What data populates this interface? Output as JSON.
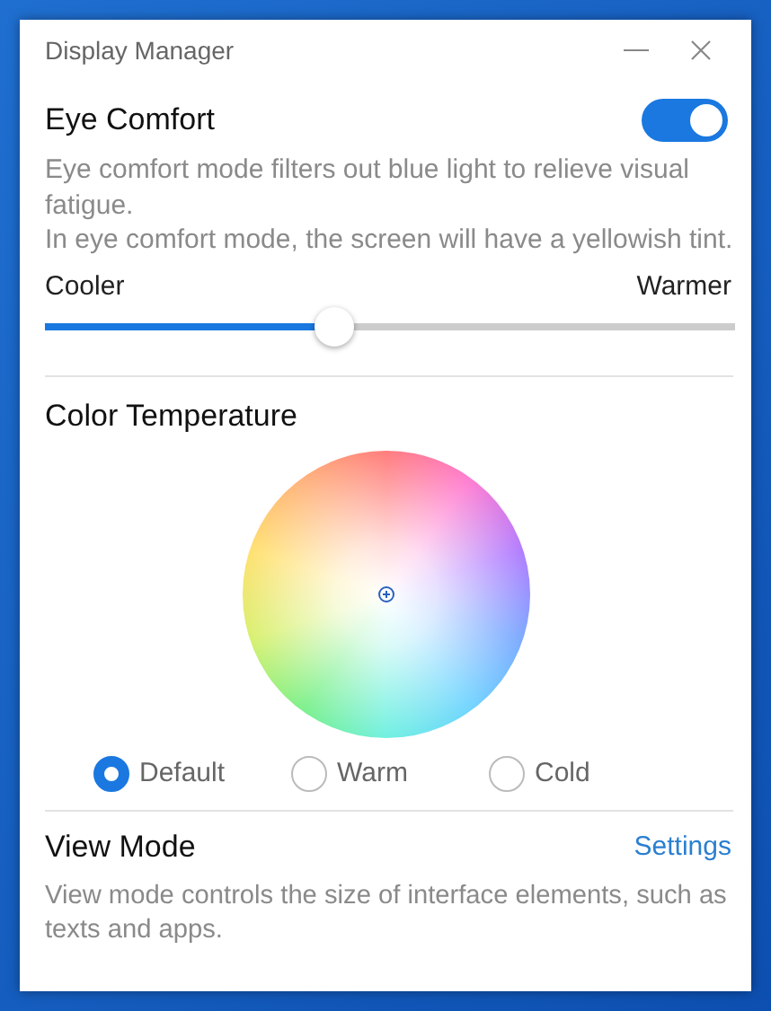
{
  "window": {
    "title": "Display Manager"
  },
  "eye_comfort": {
    "label": "Eye Comfort",
    "on": true,
    "description": [
      "Eye comfort mode filters out blue light to relieve visual fatigue.",
      "In eye comfort mode, the screen will have a yellowish tint."
    ],
    "slider": {
      "min_label": "Cooler",
      "max_label": "Warmer",
      "level": 0.42
    }
  },
  "color_temperature": {
    "label": "Color Temperature",
    "options": [
      {
        "label": "Default",
        "selected": true
      },
      {
        "label": "Warm",
        "selected": false
      },
      {
        "label": "Cold",
        "selected": false
      }
    ]
  },
  "view_mode": {
    "label": "View Mode",
    "link": "Settings",
    "description": "View mode controls the size of interface elements, such as texts and apps."
  }
}
